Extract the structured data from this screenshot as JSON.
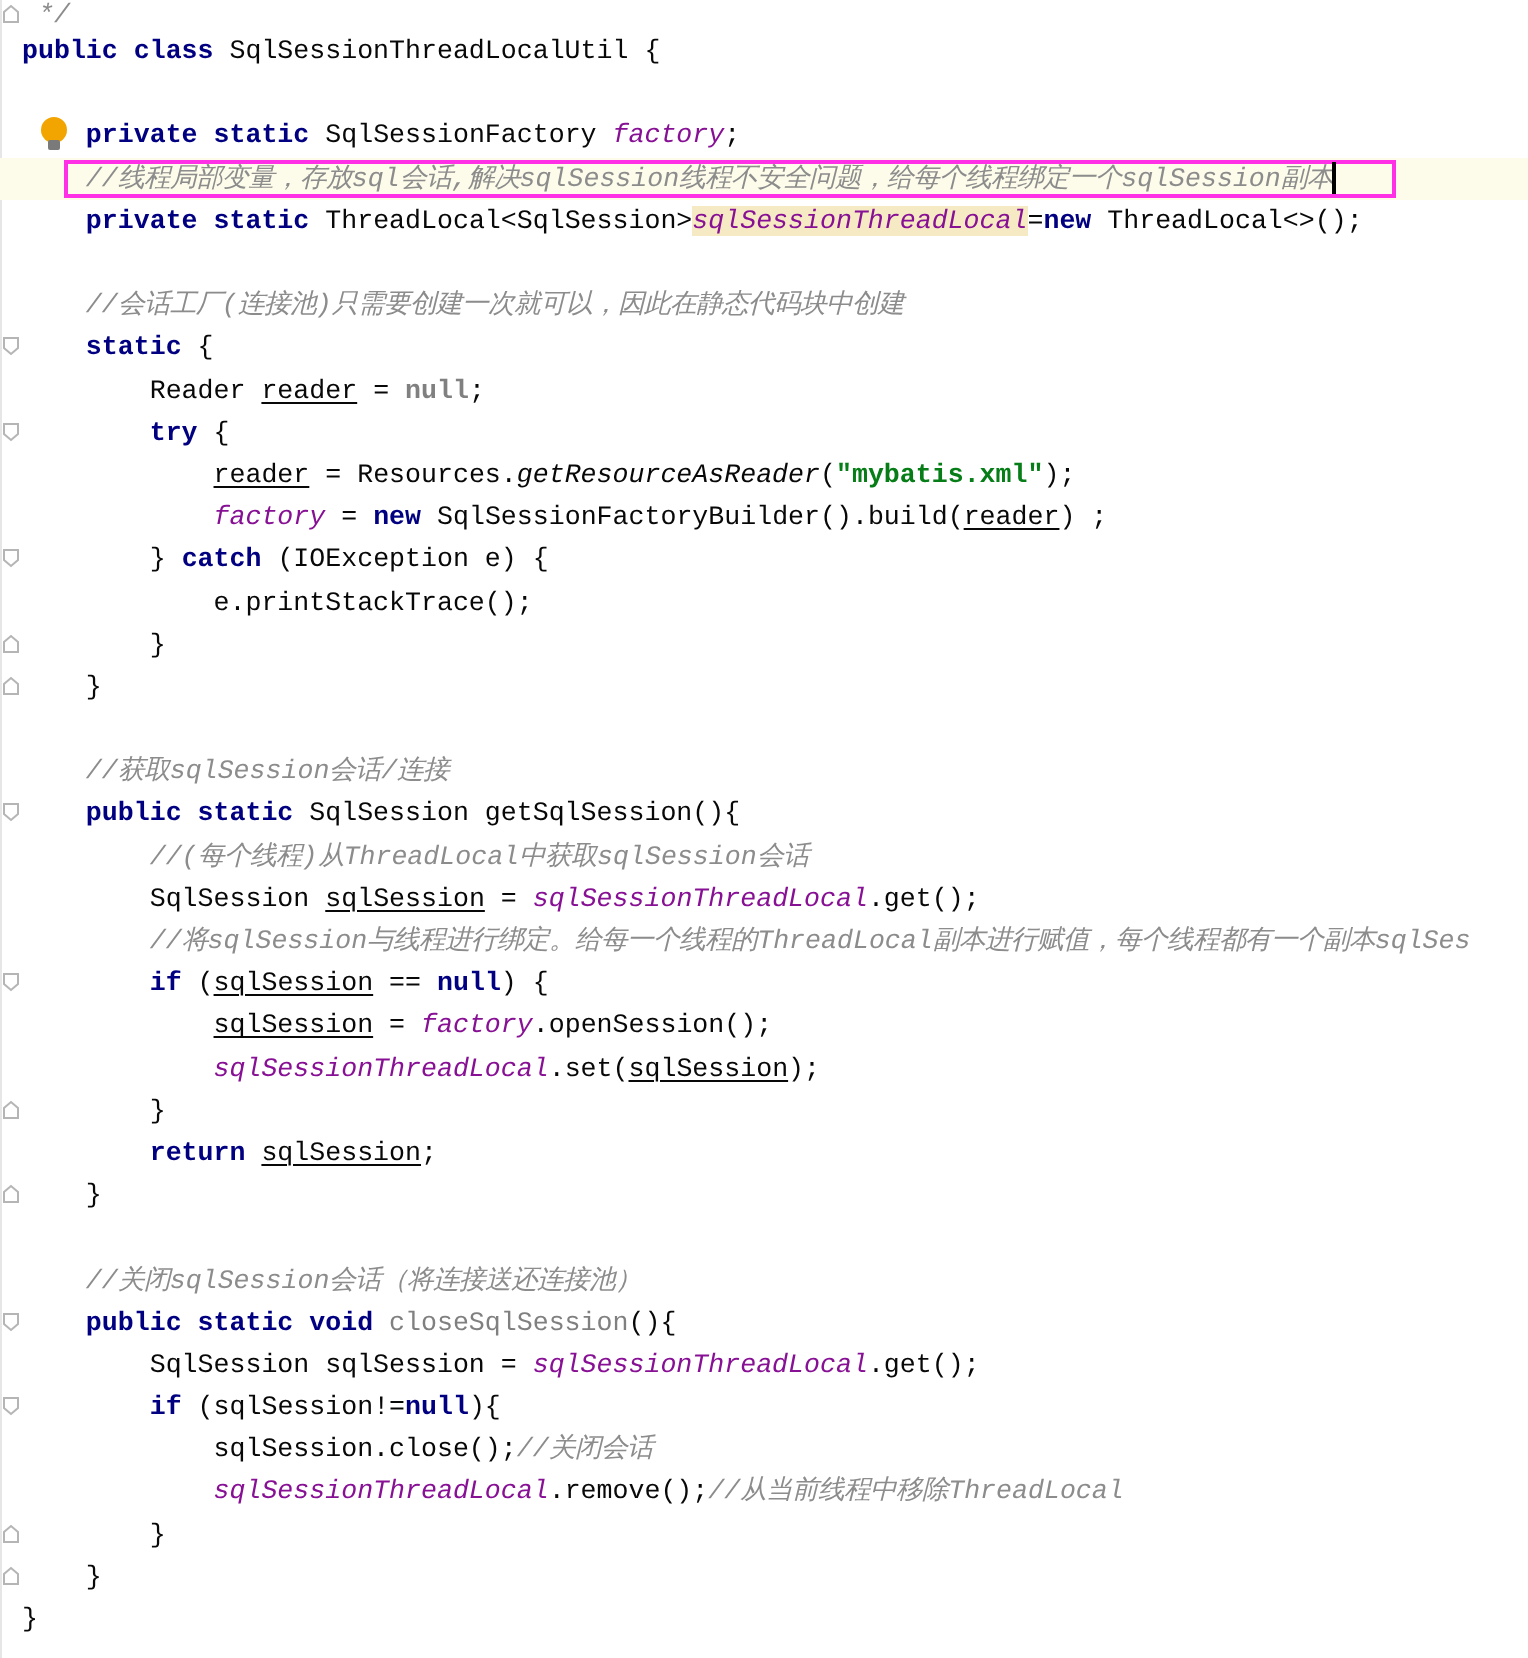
{
  "editor": {
    "lines": [
      {
        "kind": "fold_end",
        "current": false,
        "boxed": false,
        "caret": false,
        "tokens": [
          {
            "kind": "comment",
            "text": " */"
          }
        ]
      },
      {
        "kind": "plain",
        "current": false,
        "boxed": false,
        "caret": false,
        "tokens": [
          {
            "kind": "keyword",
            "text": "public class "
          },
          {
            "kind": "plain",
            "text": "SqlSessionThreadLocalUtil {"
          }
        ]
      },
      {
        "kind": "plain",
        "current": false,
        "boxed": false,
        "caret": false
      },
      {
        "kind": "bulb",
        "current": false,
        "boxed": false,
        "caret": false,
        "tokens": [
          {
            "kind": "keyword",
            "text": "    private static "
          },
          {
            "kind": "plain",
            "text": "SqlSessionFactory "
          },
          {
            "kind": "field",
            "text": "factory"
          },
          {
            "kind": "plain",
            "text": ";"
          }
        ]
      },
      {
        "kind": "plain",
        "current": true,
        "boxed": true,
        "caret": true,
        "tokens": [
          {
            "kind": "comment",
            "text": "    //线程局部变量，存放sql会话,解决sqlSession线程不安全问题，给每个线程绑定一个sqlSession副本"
          }
        ]
      },
      {
        "kind": "plain",
        "current": false,
        "boxed": false,
        "caret": false,
        "tokens": [
          {
            "kind": "keyword",
            "text": "    private static "
          },
          {
            "kind": "plain",
            "text": "ThreadLocal<SqlSession>"
          },
          {
            "kind": "field_highlight",
            "text": "sqlSessionThreadLocal"
          },
          {
            "kind": "plain",
            "text": "="
          },
          {
            "kind": "keyword",
            "text": "new "
          },
          {
            "kind": "plain",
            "text": "ThreadLocal<>();"
          }
        ]
      },
      {
        "kind": "plain",
        "current": false,
        "boxed": false,
        "caret": false
      },
      {
        "kind": "plain",
        "current": false,
        "boxed": false,
        "caret": false,
        "tokens": [
          {
            "kind": "comment",
            "text": "    //会话工厂(连接池)只需要创建一次就可以，因此在静态代码块中创建"
          }
        ]
      },
      {
        "kind": "fold_start",
        "current": false,
        "boxed": false,
        "caret": false,
        "tokens": [
          {
            "kind": "keyword",
            "text": "    static "
          },
          {
            "kind": "plain",
            "text": "{"
          }
        ]
      },
      {
        "kind": "plain",
        "current": false,
        "boxed": false,
        "caret": false,
        "tokens": [
          {
            "kind": "plain",
            "text": "        Reader "
          },
          {
            "kind": "underlined",
            "text": "reader"
          },
          {
            "kind": "plain",
            "text": " = "
          },
          {
            "kind": "unused",
            "text": "null"
          },
          {
            "kind": "plain",
            "text": ";"
          }
        ]
      },
      {
        "kind": "fold_start",
        "current": false,
        "boxed": false,
        "caret": false,
        "tokens": [
          {
            "kind": "keyword",
            "text": "        try "
          },
          {
            "kind": "plain",
            "text": "{"
          }
        ]
      },
      {
        "kind": "plain",
        "current": false,
        "boxed": false,
        "caret": false,
        "tokens": [
          {
            "kind": "underlined",
            "text": "            reader"
          },
          {
            "kind": "plain",
            "text": " = Resources."
          },
          {
            "kind": "static_method",
            "text": "getResourceAsReader"
          },
          {
            "kind": "plain",
            "text": "("
          },
          {
            "kind": "string",
            "text": "\"mybatis.xml\""
          },
          {
            "kind": "plain",
            "text": ");"
          }
        ]
      },
      {
        "kind": "plain",
        "current": false,
        "boxed": false,
        "caret": false,
        "tokens": [
          {
            "kind": "field",
            "text": "            factory"
          },
          {
            "kind": "plain",
            "text": " = "
          },
          {
            "kind": "keyword",
            "text": "new "
          },
          {
            "kind": "plain",
            "text": "SqlSessionFactoryBuilder().build("
          },
          {
            "kind": "underlined",
            "text": "reader"
          },
          {
            "kind": "plain",
            "text": ") ;"
          }
        ]
      },
      {
        "kind": "fold_start",
        "current": false,
        "boxed": false,
        "caret": false,
        "tokens": [
          {
            "kind": "plain",
            "text": "        } "
          },
          {
            "kind": "keyword",
            "text": "catch "
          },
          {
            "kind": "plain",
            "text": "(IOException e) {"
          }
        ]
      },
      {
        "kind": "plain",
        "current": false,
        "boxed": false,
        "caret": false,
        "tokens": [
          {
            "kind": "plain",
            "text": "            e.printStackTrace();"
          }
        ]
      },
      {
        "kind": "fold_end",
        "current": false,
        "boxed": false,
        "caret": false,
        "tokens": [
          {
            "kind": "plain",
            "text": "        }"
          }
        ]
      },
      {
        "kind": "fold_end",
        "current": false,
        "boxed": false,
        "caret": false,
        "tokens": [
          {
            "kind": "plain",
            "text": "    }"
          }
        ]
      },
      {
        "kind": "plain",
        "current": false,
        "boxed": false,
        "caret": false
      },
      {
        "kind": "plain",
        "current": false,
        "boxed": false,
        "caret": false,
        "tokens": [
          {
            "kind": "comment",
            "text": "    //获取sqlSession会话/连接"
          }
        ]
      },
      {
        "kind": "fold_start",
        "current": false,
        "boxed": false,
        "caret": false,
        "tokens": [
          {
            "kind": "keyword",
            "text": "    public static "
          },
          {
            "kind": "plain",
            "text": "SqlSession getSqlSession(){"
          }
        ]
      },
      {
        "kind": "plain",
        "current": false,
        "boxed": false,
        "caret": false,
        "tokens": [
          {
            "kind": "comment",
            "text": "        //(每个线程)从ThreadLocal中获取sqlSession会话"
          }
        ]
      },
      {
        "kind": "plain",
        "current": false,
        "boxed": false,
        "caret": false,
        "tokens": [
          {
            "kind": "plain",
            "text": "        SqlSession "
          },
          {
            "kind": "underlined",
            "text": "sqlSession"
          },
          {
            "kind": "plain",
            "text": " = "
          },
          {
            "kind": "field",
            "text": "sqlSessionThreadLocal"
          },
          {
            "kind": "plain",
            "text": ".get();"
          }
        ]
      },
      {
        "kind": "plain",
        "current": false,
        "boxed": false,
        "caret": false,
        "tokens": [
          {
            "kind": "comment",
            "text": "        //将sqlSession与线程进行绑定。给每一个线程的ThreadLocal副本进行赋值，每个线程都有一个副本sqlSes"
          }
        ]
      },
      {
        "kind": "fold_start",
        "current": false,
        "boxed": false,
        "caret": false,
        "tokens": [
          {
            "kind": "keyword",
            "text": "        if "
          },
          {
            "kind": "plain",
            "text": "("
          },
          {
            "kind": "underlined",
            "text": "sqlSession"
          },
          {
            "kind": "plain",
            "text": " == "
          },
          {
            "kind": "keyword",
            "text": "null"
          },
          {
            "kind": "plain",
            "text": ") {"
          }
        ]
      },
      {
        "kind": "plain",
        "current": false,
        "boxed": false,
        "caret": false,
        "tokens": [
          {
            "kind": "underlined",
            "text": "            sqlSession"
          },
          {
            "kind": "plain",
            "text": " = "
          },
          {
            "kind": "field",
            "text": "factory"
          },
          {
            "kind": "plain",
            "text": ".openSession();"
          }
        ]
      },
      {
        "kind": "plain",
        "current": false,
        "boxed": false,
        "caret": false,
        "tokens": [
          {
            "kind": "field",
            "text": "            sqlSessionThreadLocal"
          },
          {
            "kind": "plain",
            "text": ".set("
          },
          {
            "kind": "underlined",
            "text": "sqlSession"
          },
          {
            "kind": "plain",
            "text": ");"
          }
        ]
      },
      {
        "kind": "fold_end",
        "current": false,
        "boxed": false,
        "caret": false,
        "tokens": [
          {
            "kind": "plain",
            "text": "        }"
          }
        ]
      },
      {
        "kind": "plain",
        "current": false,
        "boxed": false,
        "caret": false,
        "tokens": [
          {
            "kind": "keyword",
            "text": "        return "
          },
          {
            "kind": "underlined",
            "text": "sqlSession"
          },
          {
            "kind": "plain",
            "text": ";"
          }
        ]
      },
      {
        "kind": "fold_end",
        "current": false,
        "boxed": false,
        "caret": false,
        "tokens": [
          {
            "kind": "plain",
            "text": "    }"
          }
        ]
      },
      {
        "kind": "plain",
        "current": false,
        "boxed": false,
        "caret": false
      },
      {
        "kind": "plain",
        "current": false,
        "boxed": false,
        "caret": false,
        "tokens": [
          {
            "kind": "comment",
            "text": "    //关闭sqlSession会话（将连接送还连接池）"
          }
        ]
      },
      {
        "kind": "fold_start",
        "current": false,
        "boxed": false,
        "caret": false,
        "tokens": [
          {
            "kind": "keyword",
            "text": "    public static void "
          },
          {
            "kind": "unused_method",
            "text": "closeSqlSession"
          },
          {
            "kind": "plain",
            "text": "(){"
          }
        ]
      },
      {
        "kind": "plain",
        "current": false,
        "boxed": false,
        "caret": false,
        "tokens": [
          {
            "kind": "plain",
            "text": "        SqlSession sqlSession = "
          },
          {
            "kind": "field",
            "text": "sqlSessionThreadLocal"
          },
          {
            "kind": "plain",
            "text": ".get();"
          }
        ]
      },
      {
        "kind": "fold_start",
        "current": false,
        "boxed": false,
        "caret": false,
        "tokens": [
          {
            "kind": "keyword",
            "text": "        if "
          },
          {
            "kind": "plain",
            "text": "(sqlSession!="
          },
          {
            "kind": "keyword",
            "text": "null"
          },
          {
            "kind": "plain",
            "text": "){"
          }
        ]
      },
      {
        "kind": "plain",
        "current": false,
        "boxed": false,
        "caret": false,
        "tokens": [
          {
            "kind": "plain",
            "text": "            sqlSession.close();"
          },
          {
            "kind": "comment",
            "text": "//关闭会话"
          }
        ]
      },
      {
        "kind": "plain",
        "current": false,
        "boxed": false,
        "caret": false,
        "tokens": [
          {
            "kind": "field",
            "text": "            sqlSessionThreadLocal"
          },
          {
            "kind": "plain",
            "text": ".remove();"
          },
          {
            "kind": "comment",
            "text": "//从当前线程中移除ThreadLocal"
          }
        ]
      },
      {
        "kind": "fold_end",
        "current": false,
        "boxed": false,
        "caret": false,
        "tokens": [
          {
            "kind": "plain",
            "text": "        }"
          }
        ]
      },
      {
        "kind": "fold_end",
        "current": false,
        "boxed": false,
        "caret": false,
        "tokens": [
          {
            "kind": "plain",
            "text": "    }"
          }
        ]
      },
      {
        "kind": "plain",
        "current": false,
        "boxed": false,
        "caret": false,
        "tokens": [
          {
            "kind": "plain",
            "text": "}"
          }
        ]
      }
    ]
  }
}
